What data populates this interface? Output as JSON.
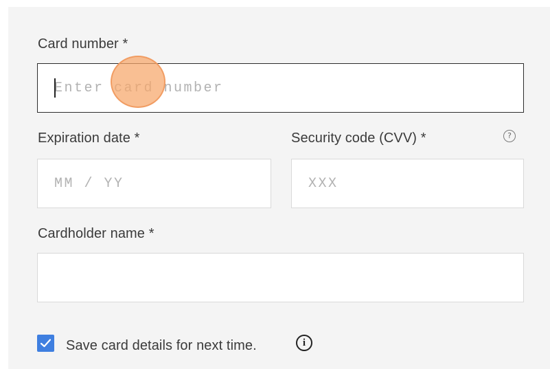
{
  "card_number": {
    "label": "Card number *",
    "placeholder": "Enter card number",
    "value": ""
  },
  "expiration": {
    "label": "Expiration date *",
    "placeholder": "MM / YY",
    "value": ""
  },
  "security_code": {
    "label": "Security code (CVV) *",
    "placeholder": "XXX",
    "value": "",
    "help_icon": "question-circle-icon",
    "help_glyph": "?"
  },
  "cardholder": {
    "label": "Cardholder name *",
    "placeholder": "",
    "value": ""
  },
  "save_card": {
    "label": "Save card details for next time.",
    "checked": true,
    "info_icon": "info-circle-icon",
    "info_glyph": "i"
  },
  "colors": {
    "checkbox": "#3f7fe0",
    "focus_border": "#2b2b2b",
    "click_highlight": "#f7a669"
  }
}
